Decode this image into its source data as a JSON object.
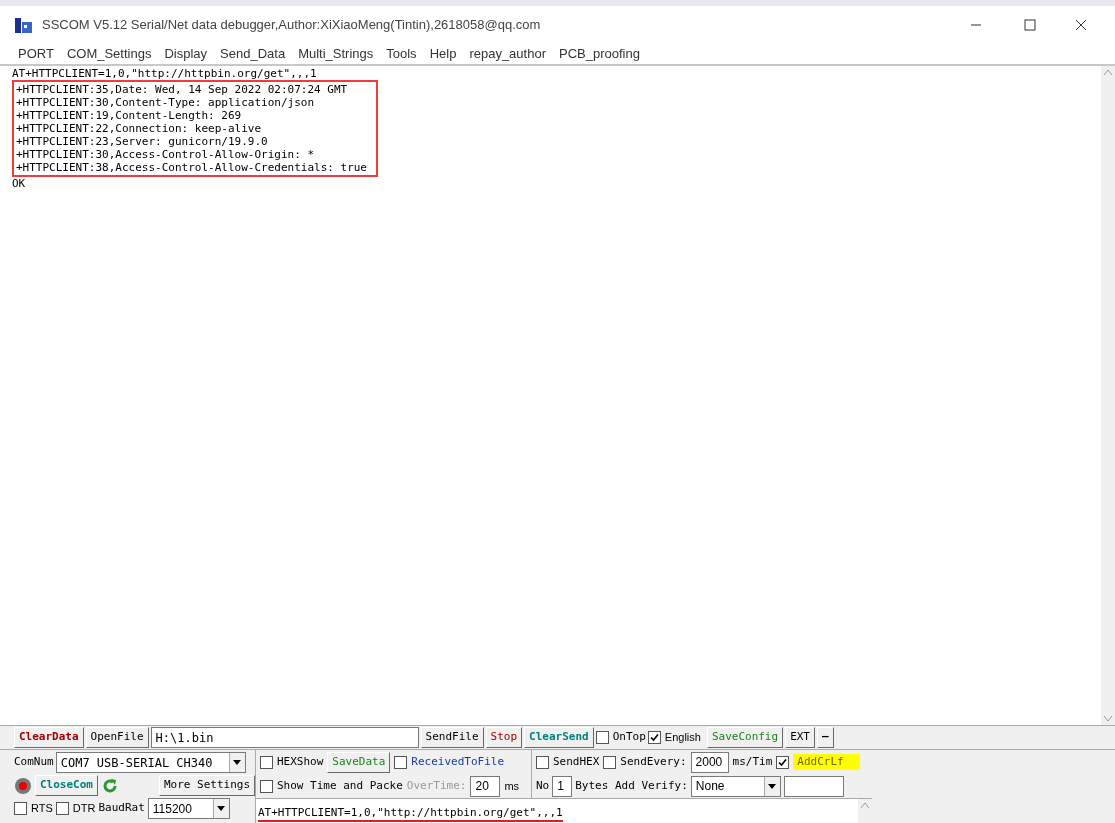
{
  "window": {
    "title": "SSCOM V5.12 Serial/Net data debugger,Author:XiXiaoMeng(Tintin),2618058@qq.com"
  },
  "menu": [
    "PORT",
    "COM_Settings",
    "Display",
    "Send_Data",
    "Multi_Strings",
    "Tools",
    "Help",
    "repay_author",
    "PCB_proofing"
  ],
  "output": {
    "lines_before": [
      "AT+HTTPCLIENT=1,0,\"http://httpbin.org/get\",,,1"
    ],
    "boxed_lines": [
      "+HTTPCLIENT:35,Date: Wed, 14 Sep 2022 02:07:24 GMT",
      "+HTTPCLIENT:30,Content-Type: application/json",
      "+HTTPCLIENT:19,Content-Length: 269",
      "+HTTPCLIENT:22,Connection: keep-alive",
      "+HTTPCLIENT:23,Server: gunicorn/19.9.0",
      "+HTTPCLIENT:30,Access-Control-Allow-Origin: *",
      "+HTTPCLIENT:38,Access-Control-Allow-Credentials: true"
    ],
    "lines_after": [
      "OK"
    ]
  },
  "toolbar": {
    "clear_data": "ClearData",
    "open_file": "OpenFile",
    "file_path": "H:\\1.bin",
    "send_file": "SendFile",
    "stop": "Stop",
    "clear_send": "ClearSend",
    "on_top": {
      "label": "OnTop",
      "checked": false
    },
    "english": {
      "label": "English",
      "checked": true
    },
    "save_config": "SaveConfig",
    "ext": "EXT",
    "minimize": "—"
  },
  "port": {
    "com_label": "ComNum",
    "com_value": "COM7 USB-SERIAL CH340",
    "close_com": "CloseCom",
    "more_settings": "More Settings",
    "rts": {
      "label": "RTS",
      "checked": false
    },
    "dtr": {
      "label": "DTR",
      "checked": false
    },
    "baud_label": "BaudRat",
    "baud_value": "115200"
  },
  "receive": {
    "hex_show": {
      "label": "HEXShow",
      "checked": false
    },
    "save_data": "SaveData",
    "received_to_file": {
      "label": "ReceivedToFile",
      "checked": false
    },
    "show_time": {
      "label": "Show Time and Packe",
      "checked": false
    },
    "overtime_label": "OverTime:",
    "overtime_value": "20",
    "overtime_unit": "ms"
  },
  "send": {
    "send_hex": {
      "label": "SendHEX",
      "checked": false
    },
    "send_every": {
      "label": "SendEvery:",
      "checked": false
    },
    "interval": "2000",
    "interval_unit": "ms/Tim",
    "add_crlf": {
      "label": "AddCrLf",
      "checked": true
    },
    "no_label": "No",
    "no_value": "1",
    "verify_label": "Bytes Add Verify:",
    "verify_value": "None",
    "text": "AT+HTTPCLIENT=1,0,\"http://httpbin.org/get\",,,1"
  }
}
